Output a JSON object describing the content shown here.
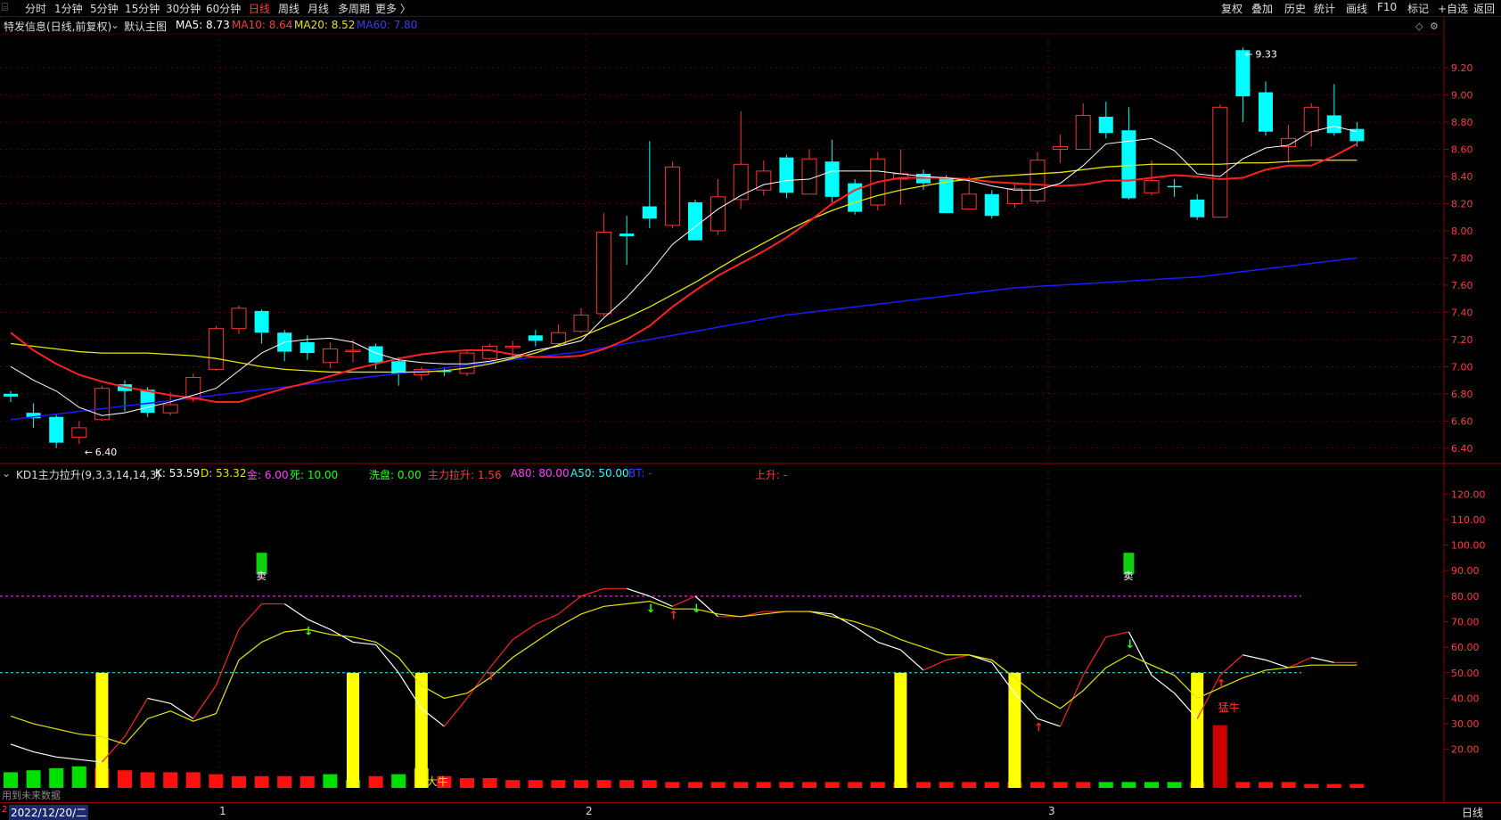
{
  "toolbar": {
    "left_items": [
      "分时",
      "1分钟",
      "5分钟",
      "15分钟",
      "30分钟",
      "60分钟",
      "日线",
      "周线",
      "月线",
      "多周期",
      "更多 〉"
    ],
    "active_index": 6,
    "right_items": [
      "复权",
      "叠加",
      "历史",
      "统计",
      "画线",
      "F10",
      "标记",
      "+自选",
      "返回"
    ]
  },
  "main_info": {
    "title": "特发信息(日线,前复权)",
    "chart_name": "默认主图",
    "ma5": "MA5: 8.73",
    "ma10": "MA10: 8.64",
    "ma20": "MA20: 8.52",
    "ma60": "MA60: 7.80"
  },
  "sub_info": {
    "indicator": "KD1主力拉升(9,3,3,14,14,3)",
    "k": "K: 53.59",
    "d": "D: 53.32",
    "gold": "金: 6.00",
    "death": "死: 10.00",
    "wash": "洗盘: 0.00",
    "lift": "主力拉升: 1.56",
    "a80": "A80: 80.00",
    "a50": "A50: 50.00",
    "bt": "BT: -",
    "rise": "上升: -"
  },
  "status": {
    "date": "2022/12/20/二",
    "months": [
      "1",
      "2",
      "3"
    ],
    "period": "日线",
    "bottom_left": "用到未来数据"
  },
  "labels": {
    "high": "9.33",
    "low": "6.40",
    "sell1": "卖",
    "sell2": "卖",
    "bull1": "大牛",
    "bull2": "猛牛"
  },
  "main_axis_ticks": [
    "9.20",
    "9.00",
    "8.80",
    "8.60",
    "8.40",
    "8.20",
    "8.00",
    "7.80",
    "7.60",
    "7.40",
    "7.20",
    "7.00",
    "6.80",
    "6.60",
    "6.40"
  ],
  "sub_axis_ticks": [
    "120.00",
    "110.00",
    "100.00",
    "90.00",
    "80.00",
    "70.00",
    "60.00",
    "50.00",
    "40.00",
    "30.00",
    "20.00"
  ],
  "colors": {
    "up": "#ff3232",
    "down": "#00ffff",
    "ma5": "#ffffff",
    "ma10": "#ff2020",
    "ma20": "#e6e600",
    "ma60": "#1a1aff",
    "grid": "#8b0000",
    "axis": "#8b0000"
  },
  "chart_data": {
    "type": "candlestick",
    "ylim": [
      6.3,
      9.45
    ],
    "candles": [
      [
        6.8,
        6.78,
        6.82,
        6.74
      ],
      [
        6.66,
        6.62,
        6.73,
        6.55
      ],
      [
        6.63,
        6.44,
        6.65,
        6.4
      ],
      [
        6.48,
        6.55,
        6.6,
        6.43
      ],
      [
        6.61,
        6.84,
        6.86,
        6.6
      ],
      [
        6.87,
        6.82,
        6.9,
        6.67
      ],
      [
        6.83,
        6.66,
        6.85,
        6.63
      ],
      [
        6.66,
        6.72,
        6.81,
        6.64
      ],
      [
        6.76,
        6.92,
        6.95,
        6.74
      ],
      [
        6.98,
        7.28,
        7.3,
        6.97
      ],
      [
        7.28,
        7.43,
        7.45,
        7.24
      ],
      [
        7.41,
        7.25,
        7.42,
        7.17
      ],
      [
        7.25,
        7.11,
        7.27,
        7.04
      ],
      [
        7.18,
        7.1,
        7.23,
        7.05
      ],
      [
        7.03,
        7.13,
        7.18,
        6.99
      ],
      [
        7.12,
        7.12,
        7.2,
        7.03
      ],
      [
        7.15,
        7.03,
        7.17,
        6.98
      ],
      [
        7.04,
        6.95,
        7.07,
        6.86
      ],
      [
        6.94,
        6.98,
        7.0,
        6.9
      ],
      [
        6.97,
        6.96,
        6.99,
        6.93
      ],
      [
        6.95,
        7.1,
        7.12,
        6.93
      ],
      [
        7.06,
        7.15,
        7.17,
        7.05
      ],
      [
        7.15,
        7.15,
        7.19,
        7.07
      ],
      [
        7.23,
        7.19,
        7.27,
        7.15
      ],
      [
        7.17,
        7.25,
        7.31,
        7.16
      ],
      [
        7.26,
        7.38,
        7.43,
        7.25
      ],
      [
        7.39,
        7.99,
        8.13,
        7.37
      ],
      [
        7.98,
        7.96,
        8.11,
        7.75
      ],
      [
        8.18,
        8.09,
        8.66,
        8.02
      ],
      [
        8.04,
        8.47,
        8.51,
        8.02
      ],
      [
        8.21,
        7.93,
        8.23,
        7.93
      ],
      [
        8.0,
        8.25,
        8.38,
        7.97
      ],
      [
        8.23,
        8.49,
        8.88,
        8.16
      ],
      [
        8.3,
        8.44,
        8.52,
        8.26
      ],
      [
        8.54,
        8.28,
        8.56,
        8.24
      ],
      [
        8.27,
        8.53,
        8.6,
        8.27
      ],
      [
        8.51,
        8.25,
        8.67,
        8.21
      ],
      [
        8.35,
        8.14,
        8.38,
        8.12
      ],
      [
        8.19,
        8.53,
        8.58,
        8.15
      ],
      [
        8.38,
        8.42,
        8.6,
        8.19
      ],
      [
        8.42,
        8.35,
        8.45,
        8.3
      ],
      [
        8.39,
        8.13,
        8.41,
        8.13
      ],
      [
        8.16,
        8.27,
        8.4,
        8.16
      ],
      [
        8.27,
        8.11,
        8.3,
        8.09
      ],
      [
        8.2,
        8.31,
        8.35,
        8.17
      ],
      [
        8.22,
        8.52,
        8.58,
        8.2
      ],
      [
        8.6,
        8.62,
        8.71,
        8.5
      ],
      [
        8.6,
        8.85,
        8.94,
        8.6
      ],
      [
        8.84,
        8.72,
        8.95,
        8.68
      ],
      [
        8.74,
        8.24,
        8.91,
        8.23
      ],
      [
        8.28,
        8.37,
        8.52,
        8.26
      ],
      [
        8.33,
        8.32,
        8.38,
        8.25
      ],
      [
        8.23,
        8.1,
        8.27,
        8.08
      ],
      [
        8.1,
        8.91,
        8.93,
        8.1
      ],
      [
        9.33,
        8.99,
        9.35,
        8.8
      ],
      [
        9.02,
        8.73,
        9.1,
        8.7
      ],
      [
        8.62,
        8.68,
        8.78,
        8.5
      ],
      [
        8.73,
        8.91,
        8.94,
        8.62
      ],
      [
        8.85,
        8.72,
        9.08,
        8.7
      ],
      [
        8.75,
        8.66,
        8.8,
        8.62
      ]
    ],
    "ma5": [
      7.0,
      6.9,
      6.82,
      6.7,
      6.64,
      6.66,
      6.7,
      6.74,
      6.79,
      6.84,
      6.97,
      7.1,
      7.18,
      7.2,
      7.21,
      7.18,
      7.1,
      7.05,
      7.03,
      7.02,
      7.02,
      7.04,
      7.07,
      7.12,
      7.15,
      7.19,
      7.36,
      7.51,
      7.69,
      7.9,
      8.03,
      8.16,
      8.26,
      8.34,
      8.37,
      8.38,
      8.44,
      8.44,
      8.44,
      8.42,
      8.4,
      8.39,
      8.37,
      8.33,
      8.3,
      8.3,
      8.35,
      8.48,
      8.64,
      8.66,
      8.68,
      8.59,
      8.42,
      8.4,
      8.53,
      8.61,
      8.63,
      8.73,
      8.77,
      8.73
    ],
    "ma10": [
      7.25,
      7.12,
      7.02,
      6.94,
      6.89,
      6.85,
      6.82,
      6.79,
      6.77,
      6.74,
      6.74,
      6.79,
      6.84,
      6.88,
      6.93,
      6.98,
      7.02,
      7.06,
      7.09,
      7.11,
      7.12,
      7.12,
      7.09,
      7.07,
      7.07,
      7.08,
      7.13,
      7.2,
      7.3,
      7.44,
      7.56,
      7.67,
      7.76,
      7.85,
      7.95,
      8.07,
      8.2,
      8.3,
      8.36,
      8.39,
      8.39,
      8.39,
      8.38,
      8.36,
      8.35,
      8.34,
      8.33,
      8.34,
      8.37,
      8.37,
      8.39,
      8.41,
      8.4,
      8.38,
      8.39,
      8.45,
      8.48,
      8.48,
      8.55,
      8.64
    ],
    "ma20": [
      7.17,
      7.15,
      7.13,
      7.11,
      7.1,
      7.1,
      7.1,
      7.09,
      7.08,
      7.06,
      7.03,
      7.0,
      6.98,
      6.97,
      6.96,
      6.96,
      6.96,
      6.96,
      6.96,
      6.97,
      6.99,
      7.02,
      7.06,
      7.1,
      7.16,
      7.22,
      7.29,
      7.36,
      7.44,
      7.53,
      7.62,
      7.72,
      7.82,
      7.91,
      8.0,
      8.08,
      8.15,
      8.21,
      8.26,
      8.3,
      8.33,
      8.36,
      8.38,
      8.4,
      8.41,
      8.42,
      8.43,
      8.45,
      8.47,
      8.48,
      8.49,
      8.49,
      8.49,
      8.49,
      8.5,
      8.5,
      8.51,
      8.52,
      8.52,
      8.52
    ],
    "ma60": [
      6.61,
      6.63,
      6.65,
      6.67,
      6.69,
      6.71,
      6.73,
      6.75,
      6.77,
      6.79,
      6.81,
      6.83,
      6.85,
      6.87,
      6.89,
      6.91,
      6.93,
      6.95,
      6.97,
      6.99,
      7.01,
      7.03,
      7.05,
      7.07,
      7.09,
      7.11,
      7.14,
      7.17,
      7.2,
      7.23,
      7.26,
      7.29,
      7.32,
      7.35,
      7.38,
      7.4,
      7.42,
      7.44,
      7.46,
      7.48,
      7.5,
      7.52,
      7.54,
      7.56,
      7.58,
      7.59,
      7.6,
      7.61,
      7.62,
      7.63,
      7.64,
      7.65,
      7.66,
      7.68,
      7.7,
      7.72,
      7.74,
      7.76,
      7.78,
      7.8
    ],
    "kd_k": [
      22,
      19,
      17,
      16,
      15,
      25,
      40,
      38,
      32,
      45,
      67,
      77,
      77,
      71,
      67,
      62,
      61,
      50,
      36,
      29,
      40,
      52,
      63,
      69,
      73,
      80,
      83,
      83,
      80,
      76,
      80,
      72,
      72,
      74,
      74,
      74,
      73,
      68,
      62,
      59,
      51,
      55,
      57,
      54,
      42,
      32,
      29,
      49,
      64,
      66,
      49,
      42,
      32,
      49,
      57,
      55,
      52,
      56,
      54,
      54
    ],
    "kd_d": [
      33,
      30,
      28,
      26,
      25,
      22,
      32,
      35,
      31,
      34,
      55,
      62,
      66,
      67,
      65,
      64,
      62,
      56,
      45,
      40,
      42,
      48,
      56,
      62,
      68,
      73,
      76,
      77,
      78,
      75,
      75,
      73,
      72,
      73,
      74,
      74,
      72,
      70,
      67,
      63,
      60,
      57,
      57,
      55,
      48,
      41,
      36,
      43,
      52,
      57,
      53,
      49,
      40,
      44,
      48,
      51,
      52,
      53,
      53,
      53
    ],
    "pillars_idx": [
      4,
      15,
      18,
      39,
      44,
      52
    ],
    "sell_idx": [
      11,
      49
    ],
    "up_arrows_idx": [
      21,
      29,
      45,
      53
    ],
    "down_arrows_idx": [
      13,
      28,
      30,
      49
    ],
    "bottom_bars": [
      [
        "g",
        0.8
      ],
      [
        "g",
        0.9
      ],
      [
        "g",
        1.0
      ],
      [
        "g",
        1.1
      ],
      [
        "r",
        1.0
      ],
      [
        "r",
        0.9
      ],
      [
        "r",
        0.8
      ],
      [
        "r",
        0.8
      ],
      [
        "r",
        0.8
      ],
      [
        "r",
        0.7
      ],
      [
        "r",
        0.6
      ],
      [
        "r",
        0.6
      ],
      [
        "r",
        0.6
      ],
      [
        "r",
        0.6
      ],
      [
        "g",
        0.7
      ],
      [
        "g",
        0.4
      ],
      [
        "r",
        0.6
      ],
      [
        "g",
        0.7
      ],
      [
        "y",
        1.0
      ],
      [
        "r",
        0.6
      ],
      [
        "r",
        0.5
      ],
      [
        "r",
        0.5
      ],
      [
        "r",
        0.4
      ],
      [
        "r",
        0.4
      ],
      [
        "r",
        0.4
      ],
      [
        "r",
        0.4
      ],
      [
        "r",
        0.4
      ],
      [
        "r",
        0.4
      ],
      [
        "r",
        0.4
      ],
      [
        "r",
        0.3
      ],
      [
        "r",
        0.3
      ],
      [
        "r",
        0.3
      ],
      [
        "r",
        0.3
      ],
      [
        "r",
        0.3
      ],
      [
        "r",
        0.3
      ],
      [
        "r",
        0.3
      ],
      [
        "r",
        0.3
      ],
      [
        "r",
        0.3
      ],
      [
        "r",
        0.3
      ],
      [
        "r",
        0.3
      ],
      [
        "r",
        0.3
      ],
      [
        "r",
        0.3
      ],
      [
        "r",
        0.3
      ],
      [
        "r",
        0.3
      ],
      [
        "r",
        0.3
      ],
      [
        "r",
        0.3
      ],
      [
        "r",
        0.3
      ],
      [
        "r",
        0.3
      ],
      [
        "g",
        0.3
      ],
      [
        "g",
        0.3
      ],
      [
        "g",
        0.3
      ],
      [
        "g",
        0.3
      ],
      [
        "r",
        0.3
      ],
      [
        "R",
        3.2
      ],
      [
        "r",
        0.3
      ],
      [
        "r",
        0.3
      ],
      [
        "r",
        0.3
      ],
      [
        "r",
        0.2
      ],
      [
        "r",
        0.2
      ],
      [
        "r",
        0.2
      ]
    ]
  }
}
